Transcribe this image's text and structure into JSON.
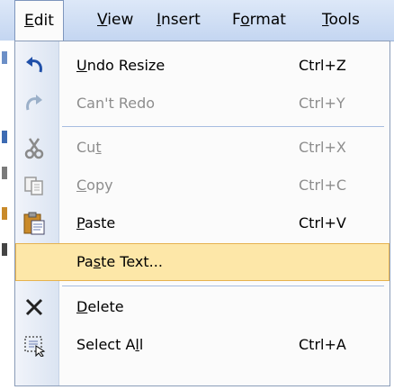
{
  "menubar": {
    "items": [
      {
        "pre": "",
        "ul": "E",
        "post": "dit"
      },
      {
        "pre": "",
        "ul": "V",
        "post": "iew"
      },
      {
        "pre": "",
        "ul": "I",
        "post": "nsert"
      },
      {
        "pre": "F",
        "ul": "o",
        "post": "rmat"
      },
      {
        "pre": "",
        "ul": "T",
        "post": "ools"
      }
    ]
  },
  "menu": {
    "items": [
      {
        "icon": "undo-icon",
        "pre": "",
        "ul": "U",
        "post": "ndo Resize",
        "shortcut": "Ctrl+Z",
        "disabled": false
      },
      {
        "icon": "redo-icon",
        "pre": "Can't Redo",
        "ul": "",
        "post": "",
        "shortcut": "Ctrl+Y",
        "disabled": true
      },
      {
        "icon": "cut-icon",
        "pre": "Cu",
        "ul": "t",
        "post": "",
        "shortcut": "Ctrl+X",
        "disabled": true
      },
      {
        "icon": "copy-icon",
        "pre": "",
        "ul": "C",
        "post": "opy",
        "shortcut": "Ctrl+C",
        "disabled": true
      },
      {
        "icon": "paste-icon",
        "pre": "",
        "ul": "P",
        "post": "aste",
        "shortcut": "Ctrl+V",
        "disabled": false
      },
      {
        "icon": "",
        "pre": "Pa",
        "ul": "s",
        "post": "te Text...",
        "shortcut": "",
        "disabled": false,
        "highlighted": true
      },
      {
        "icon": "delete-icon",
        "pre": "",
        "ul": "D",
        "post": "elete",
        "shortcut": "",
        "disabled": false
      },
      {
        "icon": "select-all-icon",
        "pre": "Select A",
        "ul": "l",
        "post": "l",
        "shortcut": "Ctrl+A",
        "disabled": false
      }
    ]
  }
}
